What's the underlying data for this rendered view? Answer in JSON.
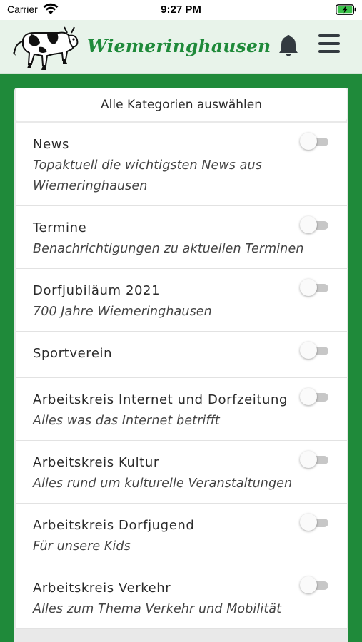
{
  "status_bar": {
    "carrier": "Carrier",
    "time": "9:27 PM"
  },
  "header": {
    "app_name": "Wiemeringhausen",
    "brand_color": "#1f8a3a",
    "notifications_icon": "bell-icon",
    "menu_icon": "hamburger-menu-icon"
  },
  "select_all_label": "Alle Kategorien auswählen",
  "categories": [
    {
      "title": "News",
      "description": "Topaktuell die wichtigsten News aus Wiemeringhausen",
      "enabled": false
    },
    {
      "title": "Termine",
      "description": "Benachrichtigungen zu aktuellen Terminen",
      "enabled": false
    },
    {
      "title": "Dorfjubiläum 2021",
      "description": "700 Jahre Wiemeringhausen",
      "enabled": false
    },
    {
      "title": "Sportverein",
      "description": "",
      "enabled": false
    },
    {
      "title": "Arbeitskreis Internet und Dorfzeitung",
      "description": "Alles was das Internet betrifft",
      "enabled": false
    },
    {
      "title": "Arbeitskreis Kultur",
      "description": "Alles rund um kulturelle Veranstaltungen",
      "enabled": false
    },
    {
      "title": "Arbeitskreis Dorfjugend",
      "description": "Für unsere Kids",
      "enabled": false
    },
    {
      "title": "Arbeitskreis Verkehr",
      "description": "Alles zum Thema Verkehr und Mobilität",
      "enabled": false
    }
  ]
}
